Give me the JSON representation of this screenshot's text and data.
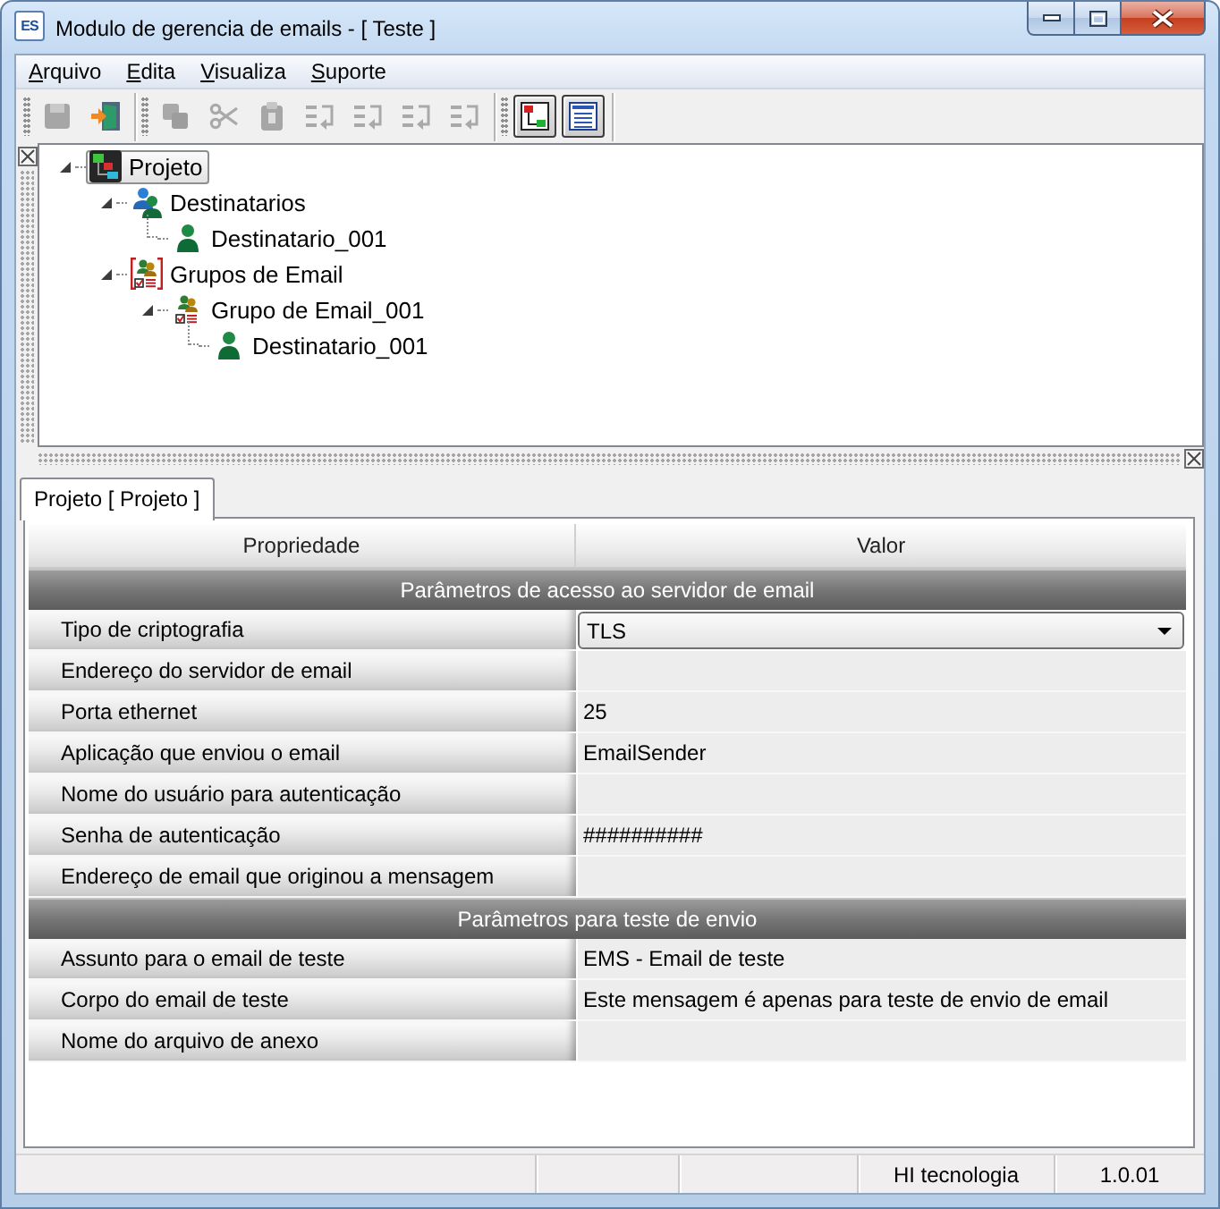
{
  "window": {
    "title": "Modulo de gerencia de emails - [ Teste ]",
    "icon_text": "ES"
  },
  "menu": [
    "Arquivo",
    "Edita",
    "Visualiza",
    "Suporte"
  ],
  "toolbar": [
    {
      "buttons": [
        {
          "disabled": true,
          "pressed": false
        },
        {
          "disabled": false,
          "pressed": false
        }
      ]
    },
    {
      "buttons": [
        {
          "disabled": true,
          "pressed": false
        },
        {
          "disabled": true,
          "pressed": false
        },
        {
          "disabled": true,
          "pressed": false
        },
        {
          "disabled": true,
          "pressed": false
        },
        {
          "disabled": true,
          "pressed": false
        },
        {
          "disabled": true,
          "pressed": false
        },
        {
          "disabled": true,
          "pressed": false
        }
      ]
    },
    {
      "buttons": [
        {
          "disabled": false,
          "pressed": true
        },
        {
          "disabled": false,
          "pressed": true
        }
      ]
    }
  ],
  "tree": [
    {
      "label": "Projeto",
      "kind": "project",
      "selected": true,
      "expanded": true,
      "children": [
        {
          "label": "Destinatarios",
          "kind": "recipients",
          "selected": false,
          "expanded": true,
          "children": [
            {
              "label": "Destinatario_001",
              "kind": "recipient",
              "selected": false
            }
          ]
        },
        {
          "label": "Grupos de Email",
          "kind": "groups",
          "selected": false,
          "expanded": true,
          "children": [
            {
              "label": "Grupo de Email_001",
              "kind": "group",
              "selected": false,
              "expanded": true,
              "children": [
                {
                  "label": "Destinatario_001",
                  "kind": "recipient",
                  "selected": false
                }
              ]
            }
          ]
        }
      ]
    }
  ],
  "tabs": [
    {
      "label": "Projeto [ Projeto ]",
      "selected": true
    }
  ],
  "grid": {
    "columns": [
      "Propriedade",
      "Valor"
    ],
    "sections": [
      {
        "title": "Parâmetros de acesso ao servidor de email",
        "rows": [
          {
            "property": "Tipo de criptografia",
            "kind": "dropdown",
            "value": "TLS"
          },
          {
            "property": "Endereço do servidor de email",
            "kind": "text"
          },
          {
            "property": "Porta ethernet",
            "kind": "text",
            "value": "25"
          },
          {
            "property": "Aplicação que enviou o email",
            "kind": "text",
            "value": "EmailSender"
          },
          {
            "property": "Nome do usuário para autenticação",
            "kind": "text"
          },
          {
            "property": "Senha de autenticação",
            "kind": "text",
            "value": "##########"
          },
          {
            "property": "Endereço de email que originou a mensagem",
            "kind": "text"
          }
        ]
      },
      {
        "title": "Parâmetros para teste de envio",
        "rows": [
          {
            "property": "Assunto para o email de teste",
            "kind": "text",
            "value": "EMS - Email de teste"
          },
          {
            "property": "Corpo do email de teste",
            "kind": "text",
            "value": "Este mensagem é apenas para teste de envio de email"
          },
          {
            "property": "Nome do arquivo de anexo",
            "kind": "text"
          }
        ]
      }
    ]
  },
  "status_bar": {
    "company": "HI tecnologia",
    "version": "1.0.01"
  }
}
